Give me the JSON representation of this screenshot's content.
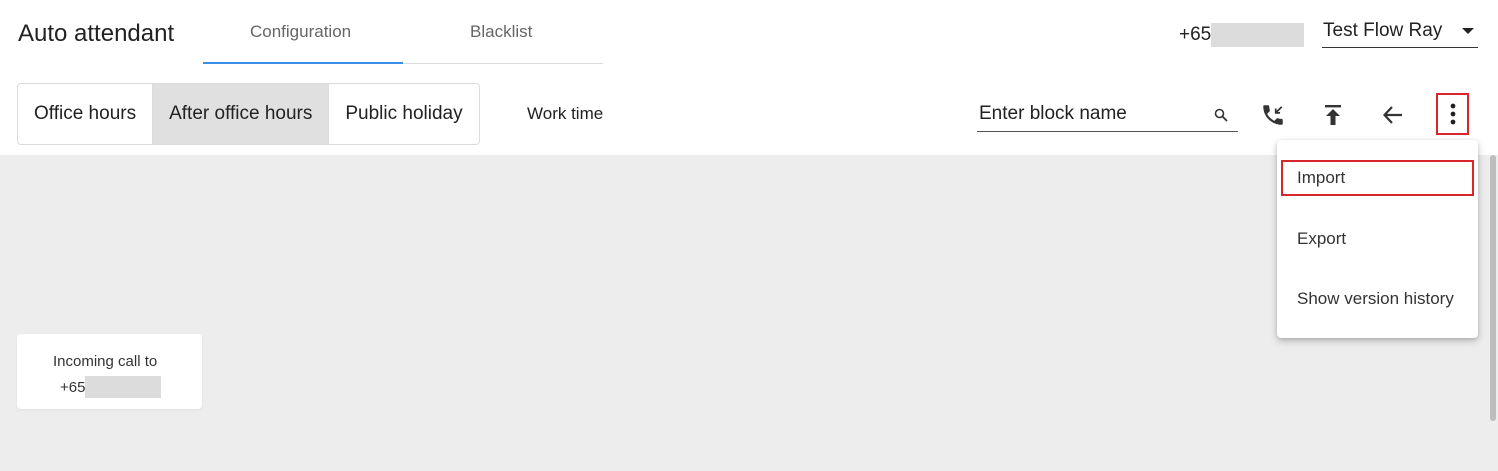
{
  "header": {
    "title": "Auto attendant",
    "tabs": [
      {
        "label": "Configuration",
        "active": true
      },
      {
        "label": "Blacklist",
        "active": false
      }
    ],
    "phone_prefix": "+65",
    "flow_select": {
      "value": "Test Flow Ray"
    }
  },
  "toolbar": {
    "segments": [
      {
        "label": "Office hours",
        "active": false
      },
      {
        "label": "After office hours",
        "active": true
      },
      {
        "label": "Public holiday",
        "active": false
      }
    ],
    "work_time_label": "Work time",
    "search": {
      "placeholder": "Enter block name",
      "value": ""
    },
    "icons": {
      "call": "incoming-call-icon",
      "top": "move-to-top-icon",
      "back": "arrow-left-icon",
      "more": "more-vertical-icon"
    }
  },
  "menu": {
    "items": [
      {
        "label": "Import",
        "highlighted": true
      },
      {
        "label": "Export",
        "highlighted": false
      },
      {
        "label": "Show version history",
        "highlighted": false
      }
    ]
  },
  "canvas": {
    "node": {
      "line1": "Incoming call to",
      "prefix": "+65"
    }
  },
  "colors": {
    "accent": "#3a8ee6",
    "highlight": "#d9262b",
    "canvas_bg": "#ededed",
    "active_segment": "#e0e0e0"
  }
}
